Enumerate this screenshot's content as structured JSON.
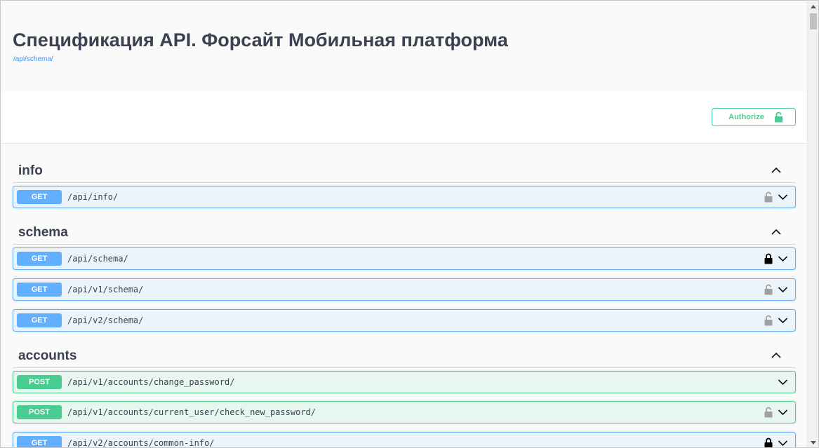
{
  "header": {
    "title": "Спецификация API. Форсайт Мобильная платформа",
    "schema_link": "/api/schema/"
  },
  "scheme": {
    "authorize_label": "Authorize"
  },
  "colors": {
    "get": "#61affe",
    "post": "#49cc90",
    "text": "#3b4151",
    "link": "#4990e2"
  },
  "tags": [
    {
      "name": "info",
      "operations": [
        {
          "method": "GET",
          "path": "/api/info/",
          "lock": "unlocked-icon"
        }
      ]
    },
    {
      "name": "schema",
      "operations": [
        {
          "method": "GET",
          "path": "/api/schema/",
          "lock": "locked-icon"
        },
        {
          "method": "GET",
          "path": "/api/v1/schema/",
          "lock": "unlocked-icon"
        },
        {
          "method": "GET",
          "path": "/api/v2/schema/",
          "lock": "unlocked-icon"
        }
      ]
    },
    {
      "name": "accounts",
      "operations": [
        {
          "method": "POST",
          "path": "/api/v1/accounts/change_password/",
          "lock": ""
        },
        {
          "method": "POST",
          "path": "/api/v1/accounts/current_user/check_new_password/",
          "lock": "unlocked-icon"
        },
        {
          "method": "GET",
          "path": "/api/v2/accounts/common-info/",
          "lock": "locked-icon"
        }
      ]
    }
  ]
}
